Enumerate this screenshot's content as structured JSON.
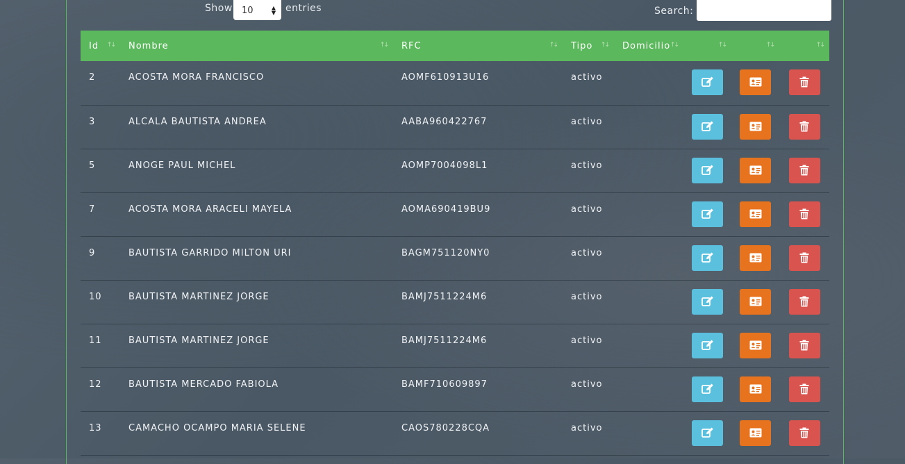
{
  "controls": {
    "show_label": "Show",
    "page_size": "10",
    "entries_label": "entries",
    "search_label": "Search:",
    "search_value": ""
  },
  "table": {
    "columns": [
      "Id",
      "Nombre",
      "RFC",
      "Tipo",
      "Domicilio",
      "",
      "",
      ""
    ],
    "rows": [
      {
        "id": "2",
        "nombre": "ACOSTA MORA FRANCISCO",
        "rfc": "AOMF610913U16",
        "tipo": "activo",
        "domicilio": ""
      },
      {
        "id": "3",
        "nombre": "ALCALA BAUTISTA ANDREA",
        "rfc": "AABA960422767",
        "tipo": "activo",
        "domicilio": ""
      },
      {
        "id": "5",
        "nombre": "ANOGE PAUL MICHEL",
        "rfc": "AOMP7004098L1",
        "tipo": "activo",
        "domicilio": ""
      },
      {
        "id": "7",
        "nombre": "ACOSTA MORA ARACELI MAYELA",
        "rfc": "AOMA690419BU9",
        "tipo": "activo",
        "domicilio": ""
      },
      {
        "id": "9",
        "nombre": "BAUTISTA GARRIDO MILTON URI",
        "rfc": "BAGM751120NY0",
        "tipo": "activo",
        "domicilio": ""
      },
      {
        "id": "10",
        "nombre": "BAUTISTA MARTINEZ JORGE",
        "rfc": "BAMJ7511224M6",
        "tipo": "activo",
        "domicilio": ""
      },
      {
        "id": "11",
        "nombre": "BAUTISTA MARTINEZ JORGE",
        "rfc": "BAMJ7511224M6",
        "tipo": "activo",
        "domicilio": ""
      },
      {
        "id": "12",
        "nombre": "BAUTISTA MERCADO FABIOLA",
        "rfc": "BAMF710609897",
        "tipo": "activo",
        "domicilio": ""
      },
      {
        "id": "13",
        "nombre": "CAMACHO OCAMPO MARIA SELENE",
        "rfc": "CAOS780228CQA",
        "tipo": "activo",
        "domicilio": ""
      }
    ]
  },
  "icons": {
    "edit": "edit-icon",
    "card": "id-card-icon",
    "delete": "trash-icon",
    "sort": "sort-icon"
  },
  "colors": {
    "header": "#5cb85c",
    "edit": "#5bc0de",
    "card": "#e8731f",
    "delete": "#d9534f"
  }
}
